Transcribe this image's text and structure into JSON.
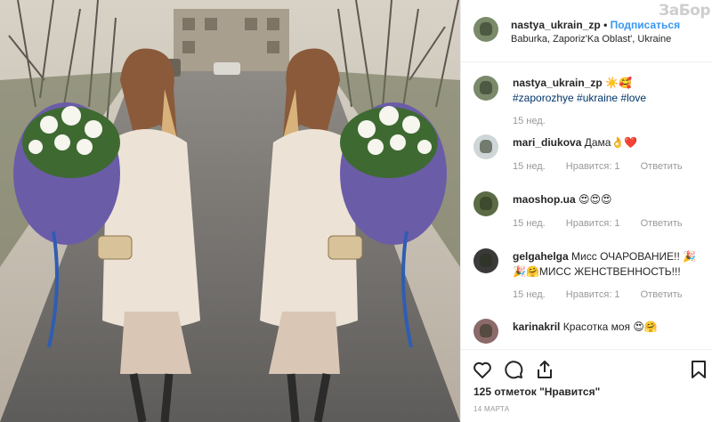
{
  "post": {
    "username": "nastya_ukrain_zp",
    "dot": "•",
    "follow_label": "Подписаться",
    "location": "Baburka, Zaporiz'Ka Oblast', Ukraine",
    "watermark": "ЗаБор"
  },
  "comments": [
    {
      "user": "nastya_ukrain_zp",
      "text": "☀️🥰",
      "tags": "#zaporozhye #ukraine #love",
      "age": "15 нед.",
      "likes": "",
      "reply": ""
    },
    {
      "user": "mari_diukova",
      "text": "Дама👌❤️",
      "age": "15 нед.",
      "likes": "Нравится: 1",
      "reply": "Ответить"
    },
    {
      "user": "maoshop.ua",
      "text": "😍😍😍",
      "age": "15 нед.",
      "likes": "Нравится: 1",
      "reply": "Ответить"
    },
    {
      "user": "gelgahelga",
      "text": "Мисс ОЧАРОВАНИЕ!! 🎉",
      "text2": "🎉🤗МИСС ЖЕНСТВЕННОСТЬ!!!",
      "age": "15 нед.",
      "likes": "Нравится: 1",
      "reply": "Ответить"
    },
    {
      "user": "karinakril",
      "text": "Красотка моя 😍🤗"
    }
  ],
  "footer": {
    "likes_count": "125 отметок",
    "likes_suffix": "\"Нравится\"",
    "date": "14 МАРТА"
  },
  "icons": [
    "heart-icon",
    "comment-icon",
    "share-icon",
    "bookmark-icon"
  ],
  "colors": {
    "link": "#3897f0",
    "hashtag": "#003569",
    "muted": "#999999",
    "text": "#262626",
    "border": "#efefef"
  }
}
